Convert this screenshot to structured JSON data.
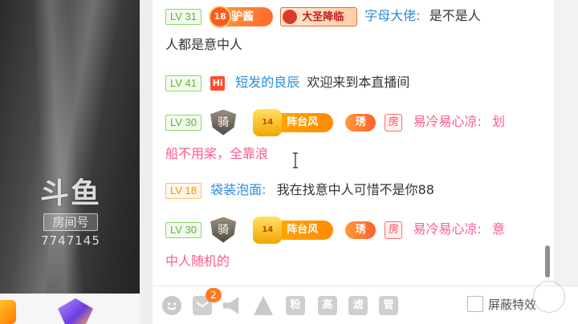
{
  "stream": {
    "watermark_logo": "斗鱼",
    "room_label": "房间号",
    "room_number": "7747145"
  },
  "chat": {
    "messages": [
      {
        "level": "LV 31",
        "noble_level": "18",
        "noble_badge": "驴酱",
        "title_badge": "大圣降临",
        "user": "字母大佬:",
        "text": "是不是人",
        "text_cont": "人都是意中人"
      },
      {
        "level": "LV 41",
        "badge": "Hi",
        "user": "短发的良辰",
        "text": "欢迎来到本直播间"
      },
      {
        "level": "LV 30",
        "shield_badge": "骑",
        "fan_level": "14",
        "fan_badge": "阵台风",
        "xiu_badge": "琇",
        "room_badge": "房",
        "user": "易冷易心凉:",
        "text": "划",
        "text_cont": "船不用桨，全靠浪"
      },
      {
        "level": "LV 18",
        "user": "袋装泡面:",
        "text": "我在找意中人可惜不是你88"
      },
      {
        "level": "LV 30",
        "shield_badge": "骑",
        "fan_level": "14",
        "fan_badge": "阵台风",
        "xiu_badge": "琇",
        "room_badge": "房",
        "user": "易冷易心凉:",
        "text": "意",
        "text_cont": "中人随机的"
      }
    ]
  },
  "toolbar": {
    "notification_count": "2",
    "btn_fans": "粉",
    "btn_high": "高",
    "btn_filter": "滤",
    "btn_manage": "管",
    "shield_label": "屏蔽特效"
  },
  "colors": {
    "level_green": "#5cb531",
    "level_orange": "#ff8a00",
    "username_blue": "#2b8cdb",
    "username_pink": "#ff5a87",
    "notify_orange": "#ff7a22"
  }
}
